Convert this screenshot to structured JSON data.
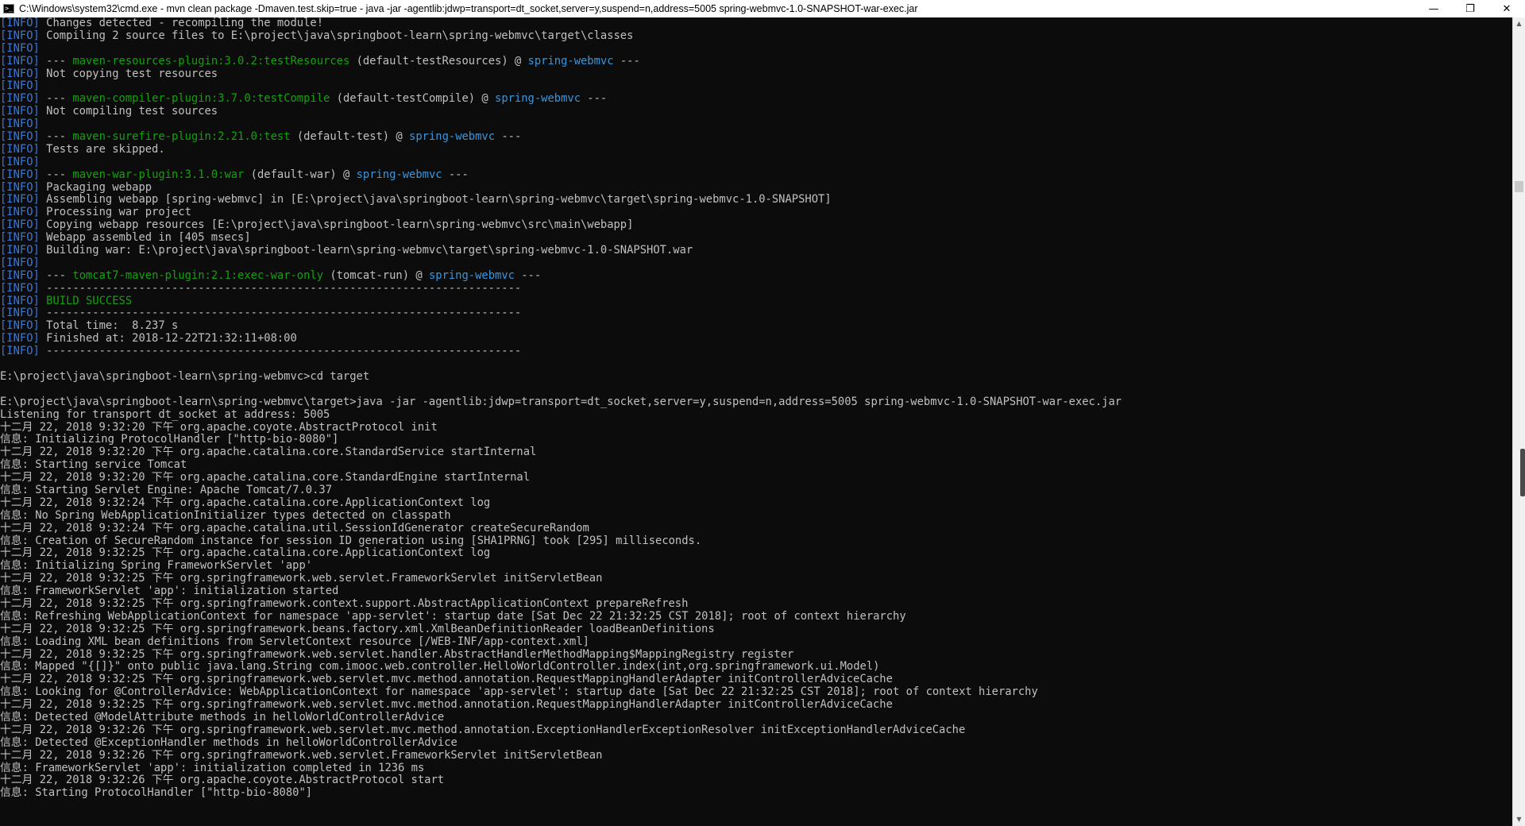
{
  "window": {
    "title": "C:\\Windows\\system32\\cmd.exe - mvn  clean package -Dmaven.test.skip=true - java  -jar -agentlib:jdwp=transport=dt_socket,server=y,suspend=n,address=5005 spring-webmvc-1.0-SNAPSHOT-war-exec.jar",
    "minimize": "—",
    "maximize": "❐",
    "close": "✕"
  },
  "colors": {
    "background": "#0c0c0c",
    "text": "#c0c0c0",
    "info": "#3a78d8",
    "green": "#13a10e",
    "cyan": "#3a96dd"
  },
  "console_lines": [
    [
      {
        "t": "[INFO]",
        "c": "info"
      },
      {
        "t": " Changes detected - recompiling the module!"
      }
    ],
    [
      {
        "t": "[INFO]",
        "c": "info"
      },
      {
        "t": " Compiling 2 source files to E:\\project\\java\\springboot-learn\\spring-webmvc\\target\\classes"
      }
    ],
    [
      {
        "t": "[INFO]",
        "c": "info"
      }
    ],
    [
      {
        "t": "[INFO]",
        "c": "info"
      },
      {
        "t": " --- "
      },
      {
        "t": "maven-resources-plugin:3.0.2:testResources",
        "c": "green"
      },
      {
        "t": " (default-testResources) @ "
      },
      {
        "t": "spring-webmvc",
        "c": "cyan"
      },
      {
        "t": " ---"
      }
    ],
    [
      {
        "t": "[INFO]",
        "c": "info"
      },
      {
        "t": " Not copying test resources"
      }
    ],
    [
      {
        "t": "[INFO]",
        "c": "info"
      }
    ],
    [
      {
        "t": "[INFO]",
        "c": "info"
      },
      {
        "t": " --- "
      },
      {
        "t": "maven-compiler-plugin:3.7.0:testCompile",
        "c": "green"
      },
      {
        "t": " (default-testCompile) @ "
      },
      {
        "t": "spring-webmvc",
        "c": "cyan"
      },
      {
        "t": " ---"
      }
    ],
    [
      {
        "t": "[INFO]",
        "c": "info"
      },
      {
        "t": " Not compiling test sources"
      }
    ],
    [
      {
        "t": "[INFO]",
        "c": "info"
      }
    ],
    [
      {
        "t": "[INFO]",
        "c": "info"
      },
      {
        "t": " --- "
      },
      {
        "t": "maven-surefire-plugin:2.21.0:test",
        "c": "green"
      },
      {
        "t": " (default-test) @ "
      },
      {
        "t": "spring-webmvc",
        "c": "cyan"
      },
      {
        "t": " ---"
      }
    ],
    [
      {
        "t": "[INFO]",
        "c": "info"
      },
      {
        "t": " Tests are skipped."
      }
    ],
    [
      {
        "t": "[INFO]",
        "c": "info"
      }
    ],
    [
      {
        "t": "[INFO]",
        "c": "info"
      },
      {
        "t": " --- "
      },
      {
        "t": "maven-war-plugin:3.1.0:war",
        "c": "green"
      },
      {
        "t": " (default-war) @ "
      },
      {
        "t": "spring-webmvc",
        "c": "cyan"
      },
      {
        "t": " ---"
      }
    ],
    [
      {
        "t": "[INFO]",
        "c": "info"
      },
      {
        "t": " Packaging webapp"
      }
    ],
    [
      {
        "t": "[INFO]",
        "c": "info"
      },
      {
        "t": " Assembling webapp [spring-webmvc] in [E:\\project\\java\\springboot-learn\\spring-webmvc\\target\\spring-webmvc-1.0-SNAPSHOT]"
      }
    ],
    [
      {
        "t": "[INFO]",
        "c": "info"
      },
      {
        "t": " Processing war project"
      }
    ],
    [
      {
        "t": "[INFO]",
        "c": "info"
      },
      {
        "t": " Copying webapp resources [E:\\project\\java\\springboot-learn\\spring-webmvc\\src\\main\\webapp]"
      }
    ],
    [
      {
        "t": "[INFO]",
        "c": "info"
      },
      {
        "t": " Webapp assembled in [405 msecs]"
      }
    ],
    [
      {
        "t": "[INFO]",
        "c": "info"
      },
      {
        "t": " Building war: E:\\project\\java\\springboot-learn\\spring-webmvc\\target\\spring-webmvc-1.0-SNAPSHOT.war"
      }
    ],
    [
      {
        "t": "[INFO]",
        "c": "info"
      }
    ],
    [
      {
        "t": "[INFO]",
        "c": "info"
      },
      {
        "t": " --- "
      },
      {
        "t": "tomcat7-maven-plugin:2.1:exec-war-only",
        "c": "green"
      },
      {
        "t": " (tomcat-run) @ "
      },
      {
        "t": "spring-webmvc",
        "c": "cyan"
      },
      {
        "t": " ---"
      }
    ],
    [
      {
        "t": "[INFO]",
        "c": "info"
      },
      {
        "t": " ------------------------------------------------------------------------"
      }
    ],
    [
      {
        "t": "[INFO]",
        "c": "info"
      },
      {
        "t": " "
      },
      {
        "t": "BUILD SUCCESS",
        "c": "green"
      }
    ],
    [
      {
        "t": "[INFO]",
        "c": "info"
      },
      {
        "t": " ------------------------------------------------------------------------"
      }
    ],
    [
      {
        "t": "[INFO]",
        "c": "info"
      },
      {
        "t": " Total time:  8.237 s"
      }
    ],
    [
      {
        "t": "[INFO]",
        "c": "info"
      },
      {
        "t": " Finished at: 2018-12-22T21:32:11+08:00"
      }
    ],
    [
      {
        "t": "[INFO]",
        "c": "info"
      },
      {
        "t": " ------------------------------------------------------------------------"
      }
    ],
    [],
    [
      {
        "t": "E:\\project\\java\\springboot-learn\\spring-webmvc>cd target"
      }
    ],
    [],
    [
      {
        "t": "E:\\project\\java\\springboot-learn\\spring-webmvc\\target>java -jar -agentlib:jdwp=transport=dt_socket,server=y,suspend=n,address=5005 spring-webmvc-1.0-SNAPSHOT-war-exec.jar"
      }
    ],
    [
      {
        "t": "Listening for transport dt_socket at address: 5005"
      }
    ],
    [
      {
        "t": "十二月 22, 2018 9:32:20 下午 org.apache.coyote.AbstractProtocol init"
      }
    ],
    [
      {
        "t": "信息: Initializing ProtocolHandler [\"http-bio-8080\"]"
      }
    ],
    [
      {
        "t": "十二月 22, 2018 9:32:20 下午 org.apache.catalina.core.StandardService startInternal"
      }
    ],
    [
      {
        "t": "信息: Starting service Tomcat"
      }
    ],
    [
      {
        "t": "十二月 22, 2018 9:32:20 下午 org.apache.catalina.core.StandardEngine startInternal"
      }
    ],
    [
      {
        "t": "信息: Starting Servlet Engine: Apache Tomcat/7.0.37"
      }
    ],
    [
      {
        "t": "十二月 22, 2018 9:32:24 下午 org.apache.catalina.core.ApplicationContext log"
      }
    ],
    [
      {
        "t": "信息: No Spring WebApplicationInitializer types detected on classpath"
      }
    ],
    [
      {
        "t": "十二月 22, 2018 9:32:24 下午 org.apache.catalina.util.SessionIdGenerator createSecureRandom"
      }
    ],
    [
      {
        "t": "信息: Creation of SecureRandom instance for session ID generation using [SHA1PRNG] took [295] milliseconds."
      }
    ],
    [
      {
        "t": "十二月 22, 2018 9:32:25 下午 org.apache.catalina.core.ApplicationContext log"
      }
    ],
    [
      {
        "t": "信息: Initializing Spring FrameworkServlet 'app'"
      }
    ],
    [
      {
        "t": "十二月 22, 2018 9:32:25 下午 org.springframework.web.servlet.FrameworkServlet initServletBean"
      }
    ],
    [
      {
        "t": "信息: FrameworkServlet 'app': initialization started"
      }
    ],
    [
      {
        "t": "十二月 22, 2018 9:32:25 下午 org.springframework.context.support.AbstractApplicationContext prepareRefresh"
      }
    ],
    [
      {
        "t": "信息: Refreshing WebApplicationContext for namespace 'app-servlet': startup date [Sat Dec 22 21:32:25 CST 2018]; root of context hierarchy"
      }
    ],
    [
      {
        "t": "十二月 22, 2018 9:32:25 下午 org.springframework.beans.factory.xml.XmlBeanDefinitionReader loadBeanDefinitions"
      }
    ],
    [
      {
        "t": "信息: Loading XML bean definitions from ServletContext resource [/WEB-INF/app-context.xml]"
      }
    ],
    [
      {
        "t": "十二月 22, 2018 9:32:25 下午 org.springframework.web.servlet.handler.AbstractHandlerMethodMapping$MappingRegistry register"
      }
    ],
    [
      {
        "t": "信息: Mapped \"{[]}\" onto public java.lang.String com.imooc.web.controller.HelloWorldController.index(int,org.springframework.ui.Model)"
      }
    ],
    [
      {
        "t": "十二月 22, 2018 9:32:25 下午 org.springframework.web.servlet.mvc.method.annotation.RequestMappingHandlerAdapter initControllerAdviceCache"
      }
    ],
    [
      {
        "t": "信息: Looking for @ControllerAdvice: WebApplicationContext for namespace 'app-servlet': startup date [Sat Dec 22 21:32:25 CST 2018]; root of context hierarchy"
      }
    ],
    [
      {
        "t": "十二月 22, 2018 9:32:25 下午 org.springframework.web.servlet.mvc.method.annotation.RequestMappingHandlerAdapter initControllerAdviceCache"
      }
    ],
    [
      {
        "t": "信息: Detected @ModelAttribute methods in helloWorldControllerAdvice"
      }
    ],
    [
      {
        "t": "十二月 22, 2018 9:32:26 下午 org.springframework.web.servlet.mvc.method.annotation.ExceptionHandlerExceptionResolver initExceptionHandlerAdviceCache"
      }
    ],
    [
      {
        "t": "信息: Detected @ExceptionHandler methods in helloWorldControllerAdvice"
      }
    ],
    [
      {
        "t": "十二月 22, 2018 9:32:26 下午 org.springframework.web.servlet.FrameworkServlet initServletBean"
      }
    ],
    [
      {
        "t": "信息: FrameworkServlet 'app': initialization completed in 1236 ms"
      }
    ],
    [
      {
        "t": "十二月 22, 2018 9:32:26 下午 org.apache.coyote.AbstractProtocol start"
      }
    ],
    [
      {
        "t": "信息: Starting ProtocolHandler [\"http-bio-8080\"]"
      }
    ]
  ]
}
